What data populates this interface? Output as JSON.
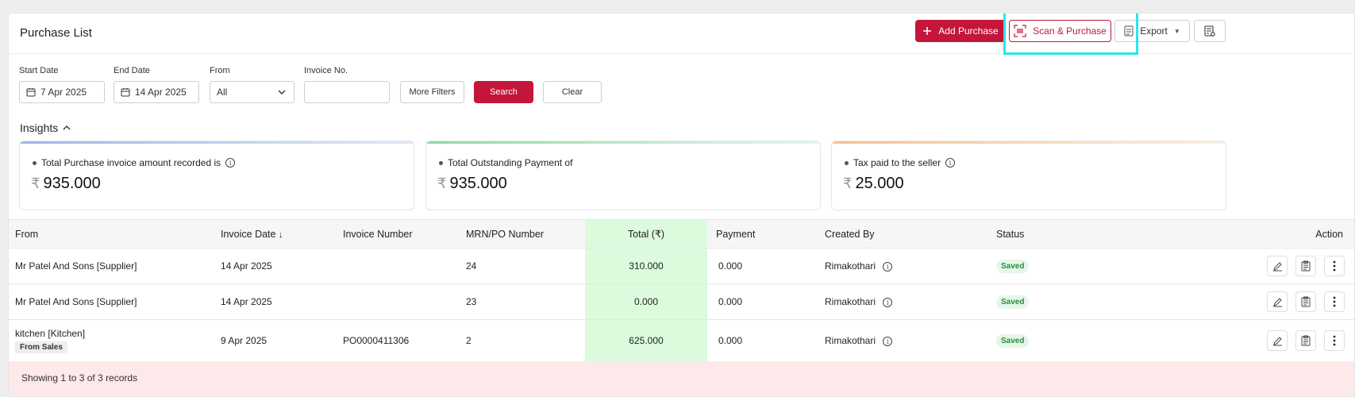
{
  "header": {
    "title": "Purchase List",
    "add_label": "Add Purchase",
    "scan_label": "Scan & Purchase",
    "export_label": "Export"
  },
  "filters": {
    "start_date_label": "Start Date",
    "start_date_value": "7 Apr 2025",
    "end_date_label": "End Date",
    "end_date_value": "14 Apr 2025",
    "from_label": "From",
    "from_value": "All",
    "invoice_label": "Invoice No.",
    "invoice_value": "",
    "more_filters_label": "More Filters",
    "search_label": "Search",
    "clear_label": "Clear"
  },
  "insights": {
    "title": "Insights",
    "currency": "₹",
    "cards": [
      {
        "label": "Total Purchase invoice amount recorded is",
        "value": "935.000"
      },
      {
        "label": "Total Outstanding Payment of",
        "value": "935.000"
      },
      {
        "label": "Tax paid to the seller",
        "value": "25.000"
      }
    ]
  },
  "table": {
    "columns": {
      "from": "From",
      "invoice_date": "Invoice Date",
      "invoice_number": "Invoice Number",
      "mrn": "MRN/PO Number",
      "total": "Total (₹)",
      "payment": "Payment",
      "created_by": "Created By",
      "status": "Status",
      "action": "Action"
    },
    "rows": [
      {
        "from": "Mr Patel And Sons [Supplier]",
        "tag": "",
        "date": "14 Apr 2025",
        "invoice": "",
        "mrn": "24",
        "total": "310.000",
        "payment": "0.000",
        "created_by": "Rimakothari",
        "status": "Saved"
      },
      {
        "from": "Mr Patel And Sons [Supplier]",
        "tag": "",
        "date": "14 Apr 2025",
        "invoice": "",
        "mrn": "23",
        "total": "0.000",
        "payment": "0.000",
        "created_by": "Rimakothari",
        "status": "Saved"
      },
      {
        "from": "kitchen [Kitchen]",
        "tag": "From Sales",
        "date": "9 Apr 2025",
        "invoice": "PO0000411306",
        "mrn": "2",
        "total": "625.000",
        "payment": "0.000",
        "created_by": "Rimakothari",
        "status": "Saved"
      }
    ]
  },
  "footer": {
    "records_text": "Showing 1 to 3 of 3 records"
  },
  "colors": {
    "accent": "#c4163a",
    "total_bg": "#dcfbdc",
    "highlight": "#27e6f0"
  }
}
